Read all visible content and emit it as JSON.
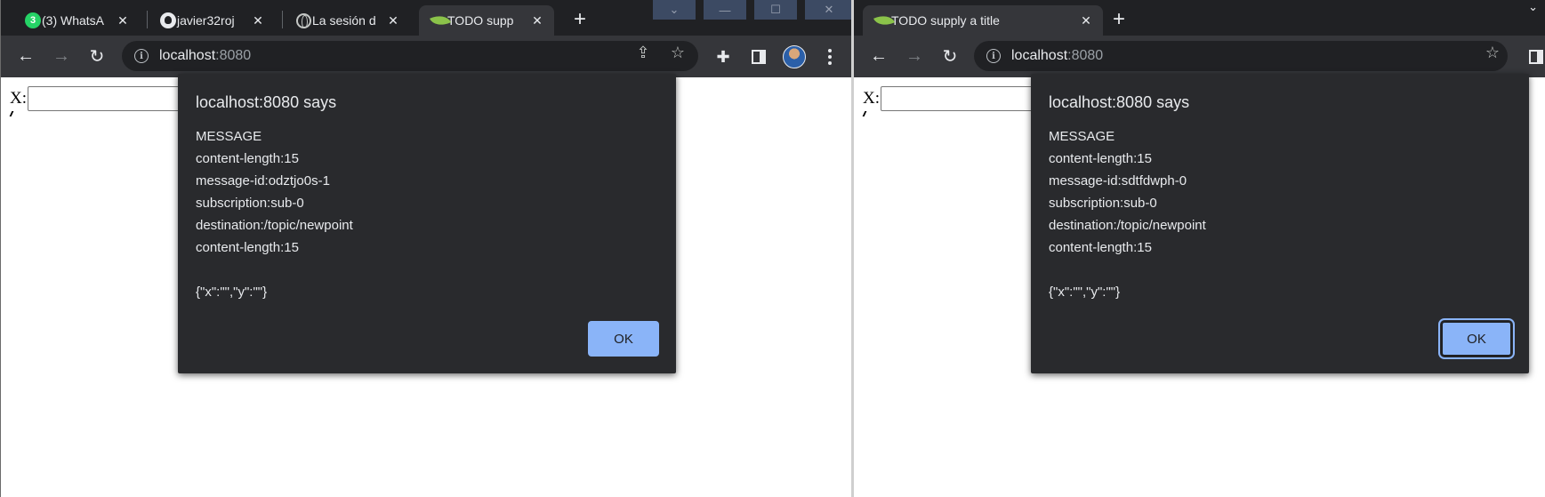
{
  "left_window": {
    "tabs": [
      {
        "title": "(3) WhatsA",
        "favicon": "whatsapp-icon",
        "badge": "3"
      },
      {
        "title": "javier32roj",
        "favicon": "github-icon"
      },
      {
        "title": "La sesión d",
        "favicon": "globe-icon"
      },
      {
        "title": "TODO supp",
        "favicon": "spring-leaf-icon",
        "active": true
      }
    ],
    "new_tab_label": "+",
    "close_glyph": "✕",
    "address": {
      "host": "localhost",
      "port": ":8080"
    },
    "page": {
      "x_label": "X:",
      "x_value": ""
    },
    "dialog": {
      "title": "localhost:8080 says",
      "lines": [
        "MESSAGE",
        "content-length:15",
        "message-id:odztjo0s-1",
        "subscription:sub-0",
        "destination:/topic/newpoint",
        "content-length:15",
        "",
        "{\"x\":\"\",\"y\":\"\"}"
      ],
      "ok_label": "OK"
    }
  },
  "right_window": {
    "tabs": [
      {
        "title": "TODO supply a title",
        "favicon": "spring-leaf-icon",
        "active": true
      }
    ],
    "new_tab_label": "+",
    "close_glyph": "✕",
    "address": {
      "host": "localhost",
      "port": ":8080"
    },
    "page": {
      "x_label": "X:",
      "x_value": ""
    },
    "dialog": {
      "title": "localhost:8080 says",
      "lines": [
        "MESSAGE",
        "content-length:15",
        "message-id:sdtfdwph-0",
        "subscription:sub-0",
        "destination:/topic/newpoint",
        "content-length:15",
        "",
        "{\"x\":\"\",\"y\":\"\"}"
      ],
      "ok_label": "OK"
    }
  },
  "colors": {
    "tabstrip": "#202124",
    "toolbar": "#35363a",
    "dialog_bg": "#292a2d",
    "ok_button": "#8ab4f8",
    "whatsapp": "#25d366",
    "spring_leaf": "#8bc34a"
  }
}
